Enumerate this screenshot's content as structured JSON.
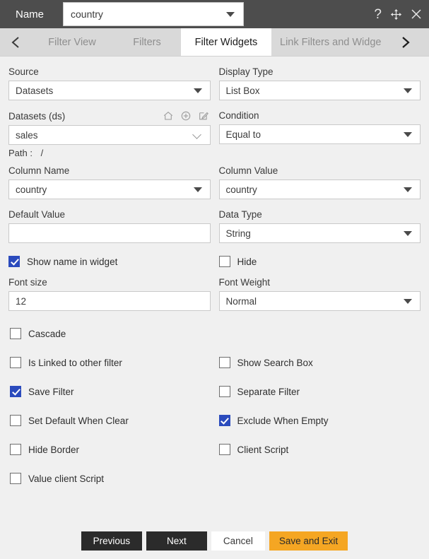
{
  "titlebar": {
    "label": "Name",
    "value": "country",
    "help_icon": "question-mark-icon",
    "move_icon": "move-icon",
    "close_icon": "close-icon"
  },
  "tabs": {
    "prev_arrow": "chevron-left-icon",
    "next_arrow": "chevron-right-icon",
    "items": [
      {
        "label": "Filter View",
        "active": false
      },
      {
        "label": "Filters",
        "active": false
      },
      {
        "label": "Filter Widgets",
        "active": true
      },
      {
        "label": "Link Filters and Widge",
        "active": false
      }
    ]
  },
  "form": {
    "source": {
      "label": "Source",
      "value": "Datasets"
    },
    "display_type": {
      "label": "Display Type",
      "value": "List Box"
    },
    "datasets": {
      "label": "Datasets (ds)",
      "value": "sales",
      "icons": [
        "home-icon",
        "plus-circle-icon",
        "edit-icon"
      ],
      "path_label": "Path :",
      "path_value": "/"
    },
    "condition": {
      "label": "Condition",
      "value": "Equal to"
    },
    "column_name": {
      "label": "Column Name",
      "value": "country"
    },
    "column_value": {
      "label": "Column Value",
      "value": "country"
    },
    "default_value": {
      "label": "Default Value",
      "value": ""
    },
    "data_type": {
      "label": "Data Type",
      "value": "String"
    },
    "font_size": {
      "label": "Font size",
      "value": "12"
    },
    "font_weight": {
      "label": "Font Weight",
      "value": "Normal"
    }
  },
  "options": {
    "show_name_in_widget": {
      "label": "Show name in widget",
      "checked": true
    },
    "hide": {
      "label": "Hide",
      "checked": false
    },
    "cascade": {
      "label": "Cascade",
      "checked": false
    },
    "is_linked": {
      "label": "Is Linked to other filter",
      "checked": false
    },
    "show_search_box": {
      "label": "Show Search Box",
      "checked": false
    },
    "save_filter": {
      "label": "Save Filter",
      "checked": true
    },
    "separate_filter": {
      "label": "Separate Filter",
      "checked": false
    },
    "set_default_when_clear": {
      "label": "Set Default When Clear",
      "checked": false
    },
    "exclude_when_empty": {
      "label": "Exclude When Empty",
      "checked": true
    },
    "hide_border": {
      "label": "Hide Border",
      "checked": false
    },
    "client_script": {
      "label": "Client Script",
      "checked": false
    },
    "value_client_script": {
      "label": "Value client Script",
      "checked": false
    }
  },
  "footer": {
    "previous": "Previous",
    "next": "Next",
    "cancel": "Cancel",
    "save_and_exit": "Save and Exit"
  },
  "colors": {
    "titlebar": "#4d4d4d",
    "tabbar": "#d9d9d9",
    "body": "#f0f0f0",
    "checkbox_checked": "#2b4bbd",
    "accent_button": "#f5a623",
    "dark_button": "#2b2b2b"
  }
}
